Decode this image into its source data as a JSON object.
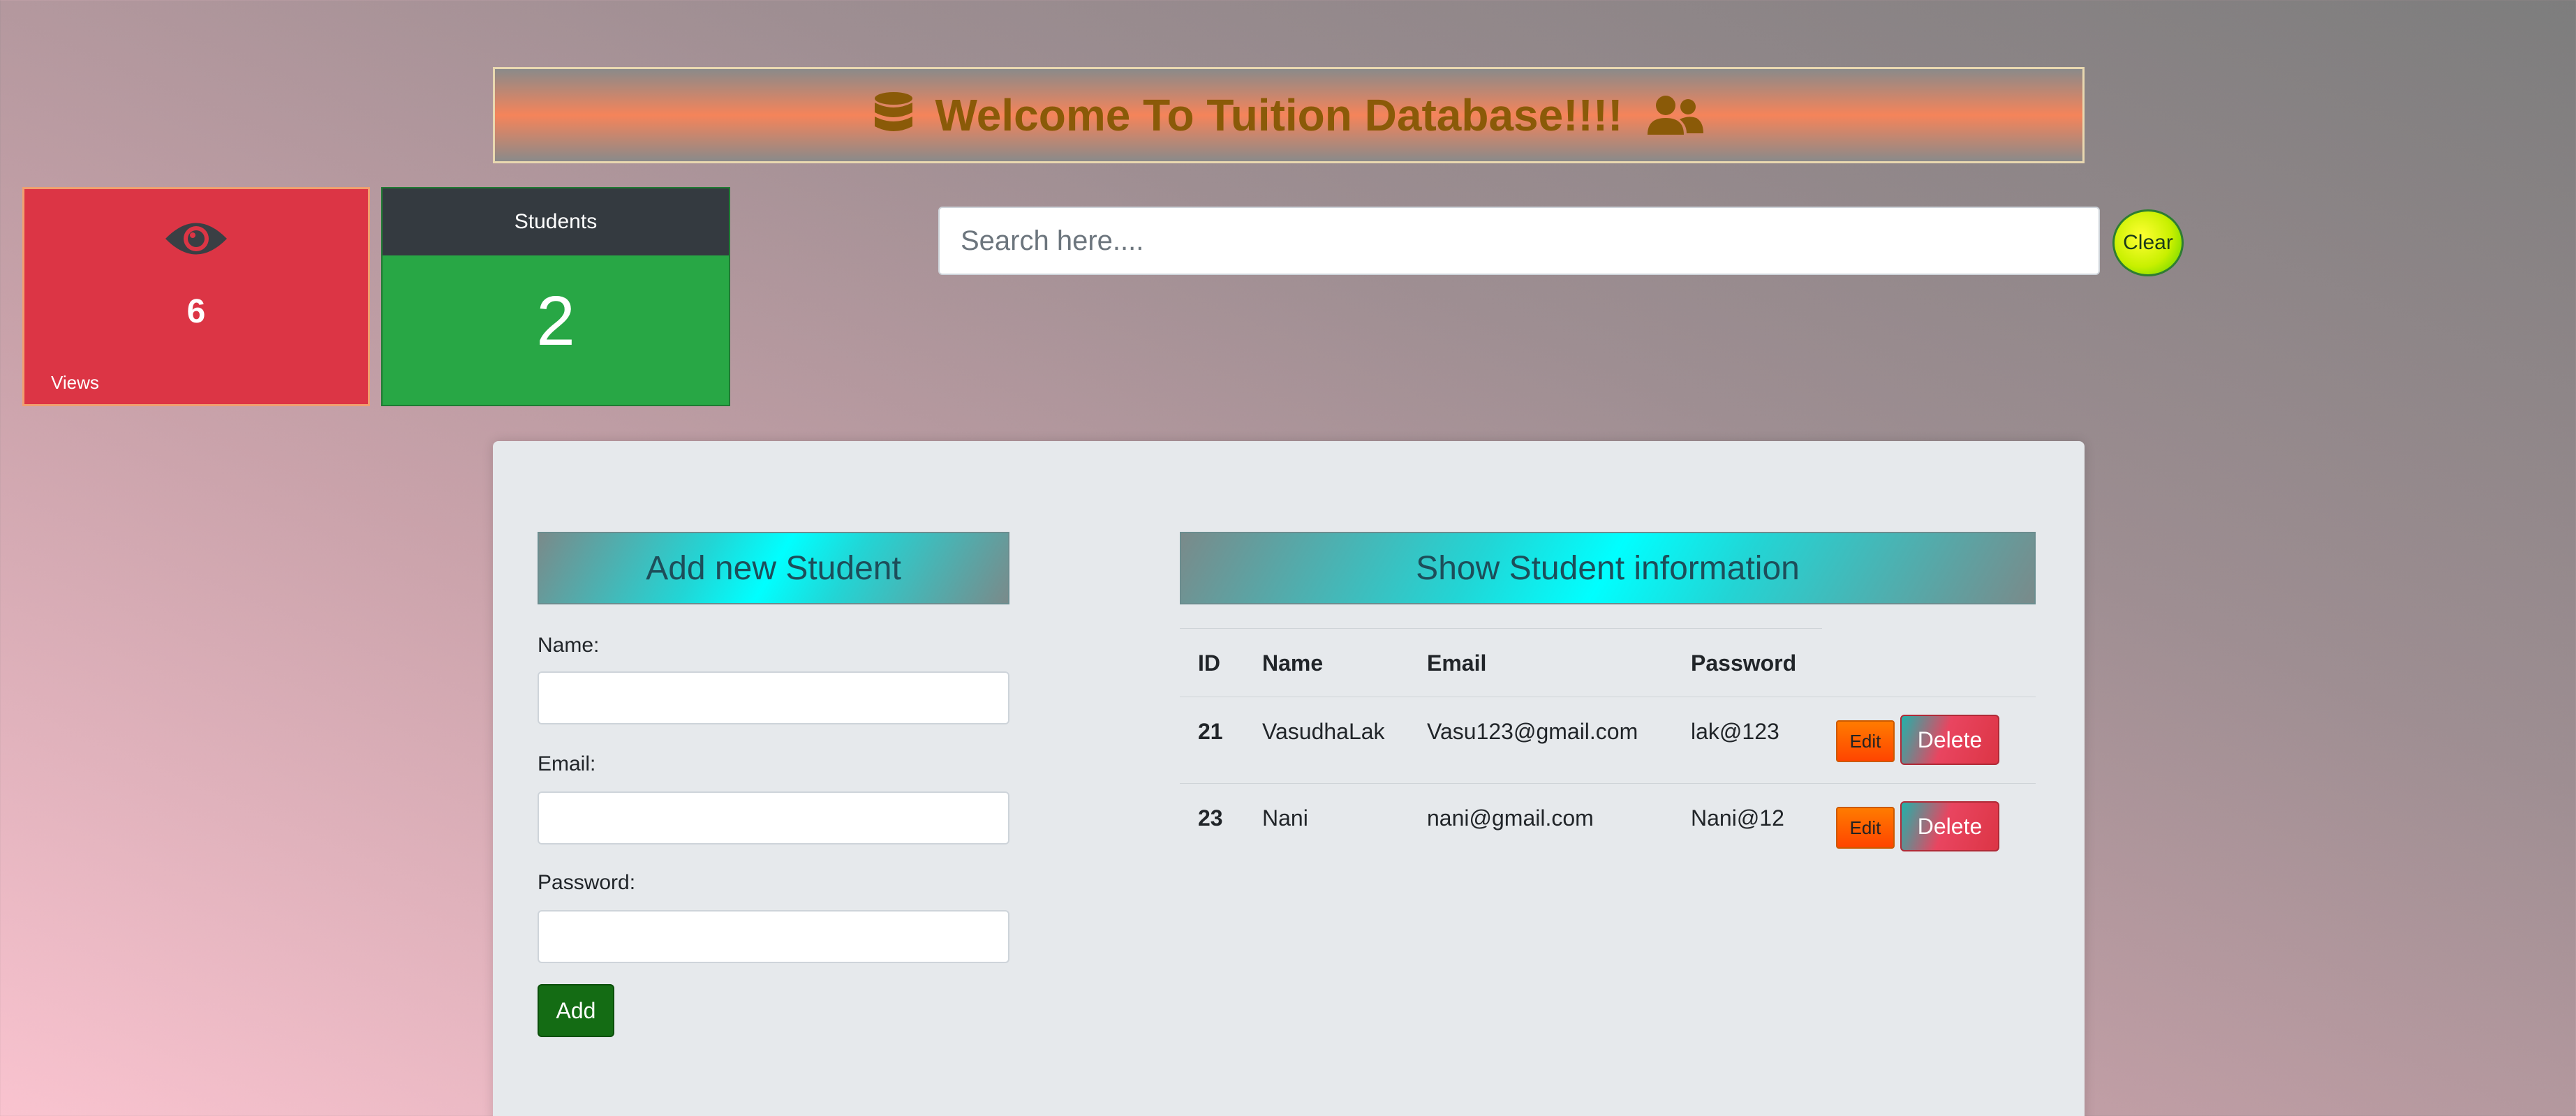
{
  "banner": {
    "title": "Welcome To Tuition Database!!!!",
    "left_icon": "database-icon",
    "right_icon": "users-icon",
    "title_color": "#8a5a08"
  },
  "stats": {
    "views": {
      "icon": "eye-icon",
      "count": "6",
      "label": "Views",
      "color": "#dc3545"
    },
    "students": {
      "header": "Students",
      "count": "2",
      "color": "#28a745"
    }
  },
  "search": {
    "placeholder": "Search here....",
    "value": "",
    "clear_label": "Clear"
  },
  "add_form": {
    "title": "Add new Student",
    "fields": [
      {
        "label": "Name:",
        "value": ""
      },
      {
        "label": "Email:",
        "value": ""
      },
      {
        "label": "Password:",
        "value": ""
      }
    ],
    "submit_label": "Add"
  },
  "student_table": {
    "title": "Show Student information",
    "columns": [
      "ID",
      "Name",
      "Email",
      "Password"
    ],
    "rows": [
      {
        "id": "21",
        "name": "VasudhaLak",
        "email": "Vasu123@gmail.com",
        "password": "lak@123",
        "edit_label": "Edit",
        "delete_label": "Delete"
      },
      {
        "id": "23",
        "name": "Nani",
        "email": "nani@gmail.com",
        "password": "Nani@12",
        "edit_label": "Edit",
        "delete_label": "Delete"
      }
    ]
  }
}
